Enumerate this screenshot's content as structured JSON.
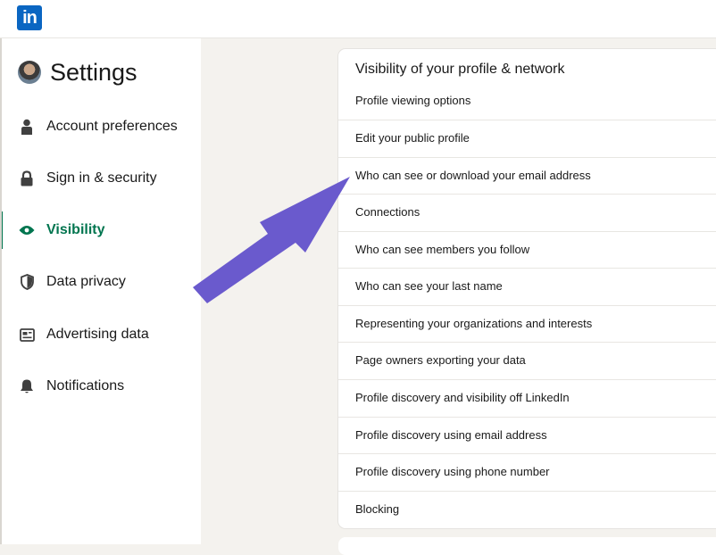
{
  "settings": {
    "title": "Settings"
  },
  "sidebar": {
    "items": [
      {
        "label": "Account preferences",
        "icon": "person-icon",
        "active": false
      },
      {
        "label": "Sign in & security",
        "icon": "lock-icon",
        "active": false
      },
      {
        "label": "Visibility",
        "icon": "eye-icon",
        "active": true
      },
      {
        "label": "Data privacy",
        "icon": "shield-icon",
        "active": false
      },
      {
        "label": "Advertising data",
        "icon": "newspaper-icon",
        "active": false
      },
      {
        "label": "Notifications",
        "icon": "bell-icon",
        "active": false
      }
    ]
  },
  "main": {
    "section_title": "Visibility of your profile & network",
    "options": [
      "Profile viewing options",
      "Edit your public profile",
      "Who can see or download your email address",
      "Connections",
      "Who can see members you follow",
      "Who can see your last name",
      "Representing your organizations and interests",
      "Page owners exporting your data",
      "Profile discovery and visibility off LinkedIn",
      "Profile discovery using email address",
      "Profile discovery using phone number",
      "Blocking"
    ]
  },
  "colors": {
    "brand": "#0a66c2",
    "active": "#01754f",
    "annotation_arrow": "#6a5acd",
    "background": "#f4f2ee"
  }
}
